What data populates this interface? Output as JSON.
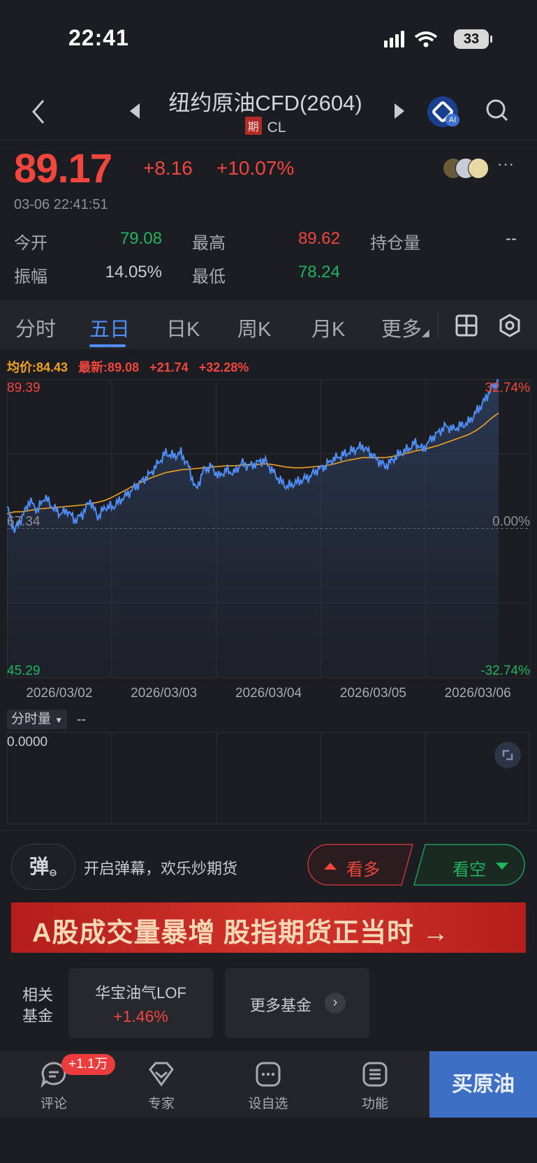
{
  "status_bar": {
    "time": "22:41",
    "battery": "33"
  },
  "header": {
    "title": "纽约原油CFD(2604)",
    "badge": "期",
    "code": "CL",
    "ai_tag": "AI"
  },
  "quote": {
    "price": "89.17",
    "change": "+8.16",
    "change_pct": "+10.07%",
    "timestamp": "03-06 22:41:51",
    "fields": [
      {
        "label": "今开",
        "value": "79.08",
        "color": "#1db55e"
      },
      {
        "label": "最高",
        "value": "89.62",
        "color": "#f0463d"
      },
      {
        "label": "持仓量",
        "value": "--",
        "color": "#c9cbd2"
      },
      {
        "label": "振幅",
        "value": "14.05%",
        "color": "#c9cbd2"
      },
      {
        "label": "最低",
        "value": "78.24",
        "color": "#1db55e"
      }
    ]
  },
  "tabs": [
    "分时",
    "五日",
    "日K",
    "周K",
    "月K",
    "更多"
  ],
  "active_tab": "五日",
  "chart_legend": {
    "avg": "均价:84.43",
    "latest": "最新:89.08",
    "change": "+21.74",
    "change_pct": "+32.28%"
  },
  "chart_data": {
    "type": "line",
    "x_labels": [
      "2026/03/02",
      "2026/03/03",
      "2026/03/04",
      "2026/03/05",
      "2026/03/06"
    ],
    "ylim": [
      45.29,
      89.39
    ],
    "y_left_labels": [
      "89.39",
      "67.34",
      "45.29"
    ],
    "y_right_labels": [
      "32.74%",
      "0.00%",
      "-32.74%"
    ],
    "baseline": 67.34,
    "series": [
      {
        "values": [
          70.5,
          67.0,
          69.0,
          71.5,
          70.0,
          72.0,
          70.5,
          69.5,
          70.0,
          68.5,
          69.5,
          71.5,
          69.0,
          70.5,
          70.5,
          71.5,
          72.5,
          73.5,
          74.5,
          75.5,
          77.0,
          78.5,
          78.0,
          78.5,
          76.5,
          73.0,
          76.0,
          76.5,
          75.0,
          76.0,
          75.5,
          77.0,
          76.5,
          77.0,
          77.5,
          76.0,
          74.5,
          73.5,
          74.0,
          74.5,
          75.0,
          76.0,
          76.5,
          77.5,
          78.0,
          78.5,
          79.0,
          79.5,
          78.5,
          77.5,
          76.5,
          77.5,
          78.5,
          79.0,
          80.0,
          79.0,
          80.5,
          81.5,
          82.5,
          82.0,
          82.5,
          83.0,
          84.5,
          86.0,
          88.0,
          89.1
        ]
      },
      {
        "values": [
          69.5,
          69.8,
          69.8,
          70.0,
          70.2,
          70.3,
          70.4,
          70.5,
          70.6,
          70.7,
          70.8,
          71.0,
          71.2,
          71.5,
          72.0,
          72.6,
          73.2,
          73.8,
          74.3,
          74.8,
          75.2,
          75.6,
          75.8,
          76.0,
          76.1,
          76.2,
          76.3,
          76.4,
          76.5,
          76.6,
          76.6,
          76.7,
          76.8,
          76.8,
          76.9,
          76.8,
          76.6,
          76.4,
          76.3,
          76.3,
          76.4,
          76.5,
          76.6,
          76.8,
          77.1,
          77.4,
          77.6,
          77.8,
          77.8,
          77.8,
          77.8,
          78.0,
          78.2,
          78.5,
          78.8,
          79.0,
          79.3,
          79.6,
          80.0,
          80.4,
          80.8,
          81.2,
          81.8,
          82.6,
          83.6,
          84.4
        ]
      }
    ]
  },
  "volume": {
    "selector": "分时量",
    "value": "--",
    "axis_zero": "0.0000"
  },
  "danmu": {
    "icon_label": "弹",
    "text": "开启弹幕，欢乐炒期货"
  },
  "sentiment": {
    "bull_label": "看多",
    "bear_label": "看空"
  },
  "banner": {
    "text": "A股成交量暴增 股指期货正当时 →"
  },
  "related_funds": {
    "label_line1": "相关",
    "label_line2": "基金",
    "fund_name": "华宝油气LOF",
    "fund_change": "+1.46%",
    "more_label": "更多基金"
  },
  "bottom_bar": {
    "items": [
      "评论",
      "专家",
      "设自选",
      "功能"
    ],
    "comment_badge": "+1.1万",
    "buy_label": "买原油"
  }
}
